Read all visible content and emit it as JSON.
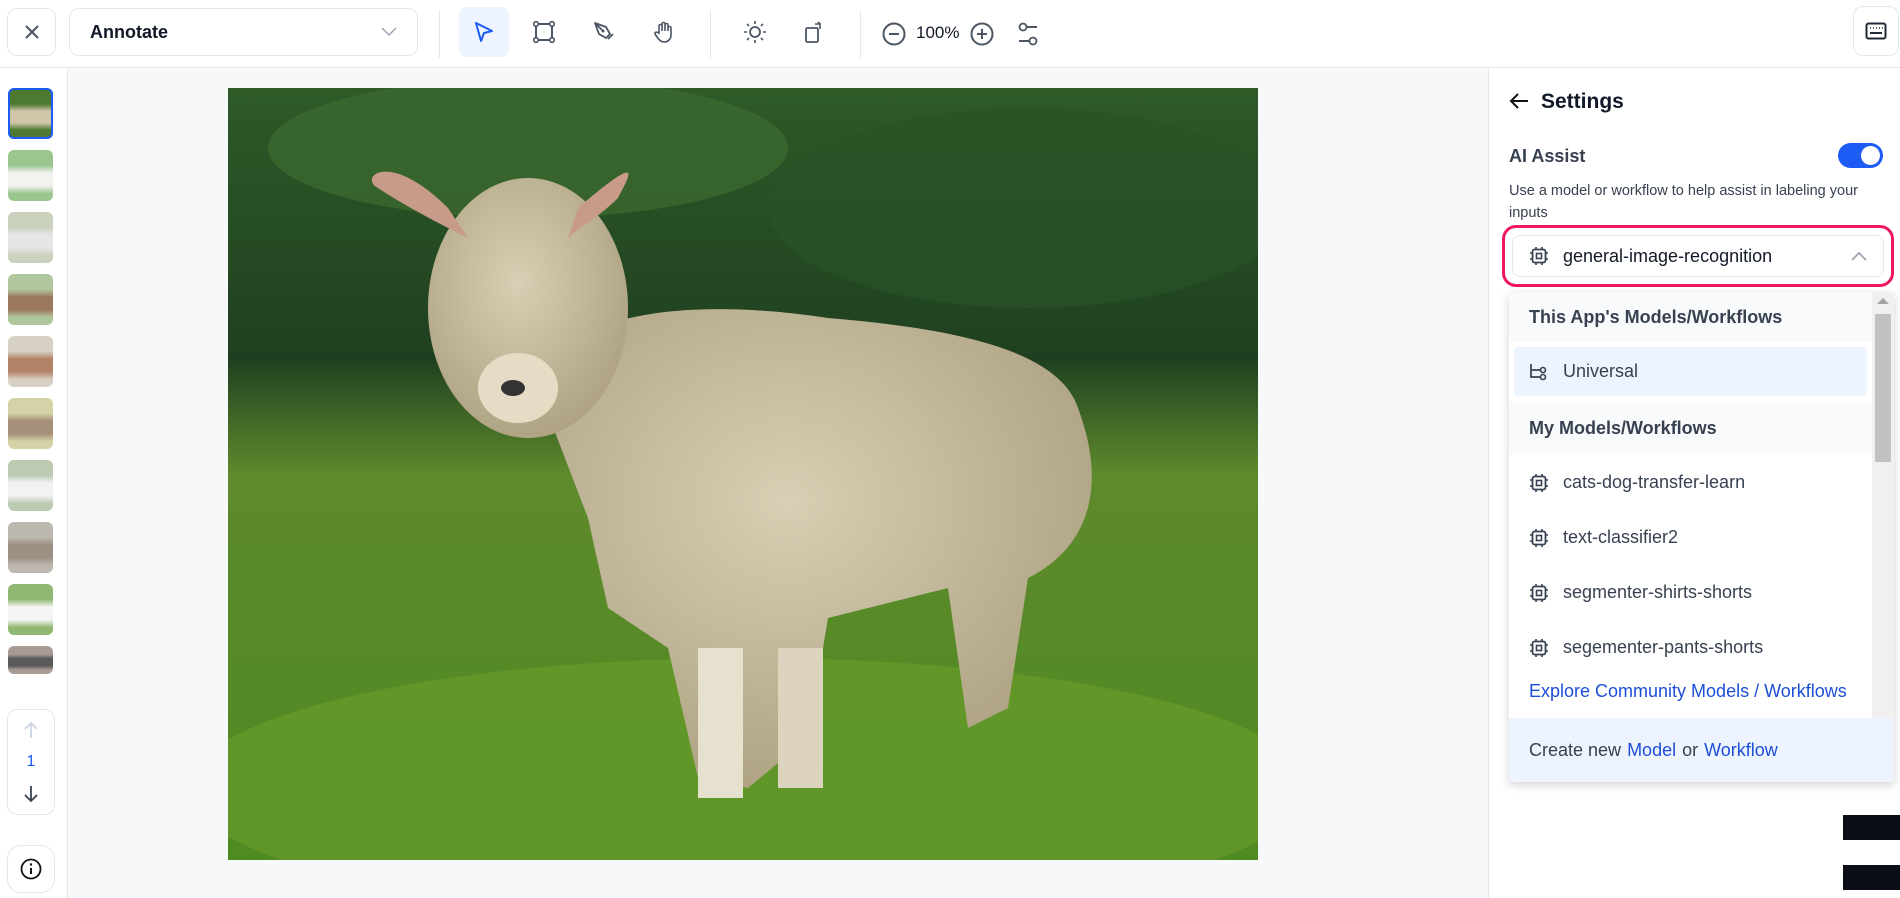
{
  "toolbar": {
    "mode_select": "Annotate",
    "zoom_level": "100%",
    "tools": [
      {
        "icon": "pointer-icon",
        "active": true
      },
      {
        "icon": "bounding-box-icon"
      },
      {
        "icon": "pen-icon"
      },
      {
        "icon": "hand-icon"
      }
    ],
    "adjust_tools": [
      {
        "icon": "brightness-icon"
      },
      {
        "icon": "rotate-icon"
      }
    ]
  },
  "sidebar": {
    "page_number": "1",
    "thumbnail_count": 10,
    "selected_index": 0
  },
  "settings": {
    "title": "Settings",
    "ai_assist_label": "AI Assist",
    "ai_assist_enabled": true,
    "ai_assist_description": "Use a model or workflow to help assist in labeling your inputs",
    "selected_model": "general-image-recognition",
    "dropdown": {
      "section_app": "This App's Models/Workflows",
      "app_items": [
        {
          "label": "Universal",
          "icon": "workflow-icon"
        }
      ],
      "section_mine": "My Models/Workflows",
      "my_items": [
        {
          "label": "cats-dog-transfer-learn",
          "icon": "chip-icon"
        },
        {
          "label": "text-classifier2",
          "icon": "chip-icon"
        },
        {
          "label": "segmenter-shirts-shorts",
          "icon": "chip-icon"
        },
        {
          "label": "segementer-pants-shorts",
          "icon": "chip-icon"
        }
      ],
      "explore_link": "Explore Community Models / Workflows",
      "create_prefix": "Create new",
      "create_model": "Model",
      "create_or": "or",
      "create_workflow": "Workflow"
    }
  },
  "colors": {
    "accent": "#1d5bf5",
    "highlight_border": "#f0185c",
    "link": "#1d4ed8"
  }
}
